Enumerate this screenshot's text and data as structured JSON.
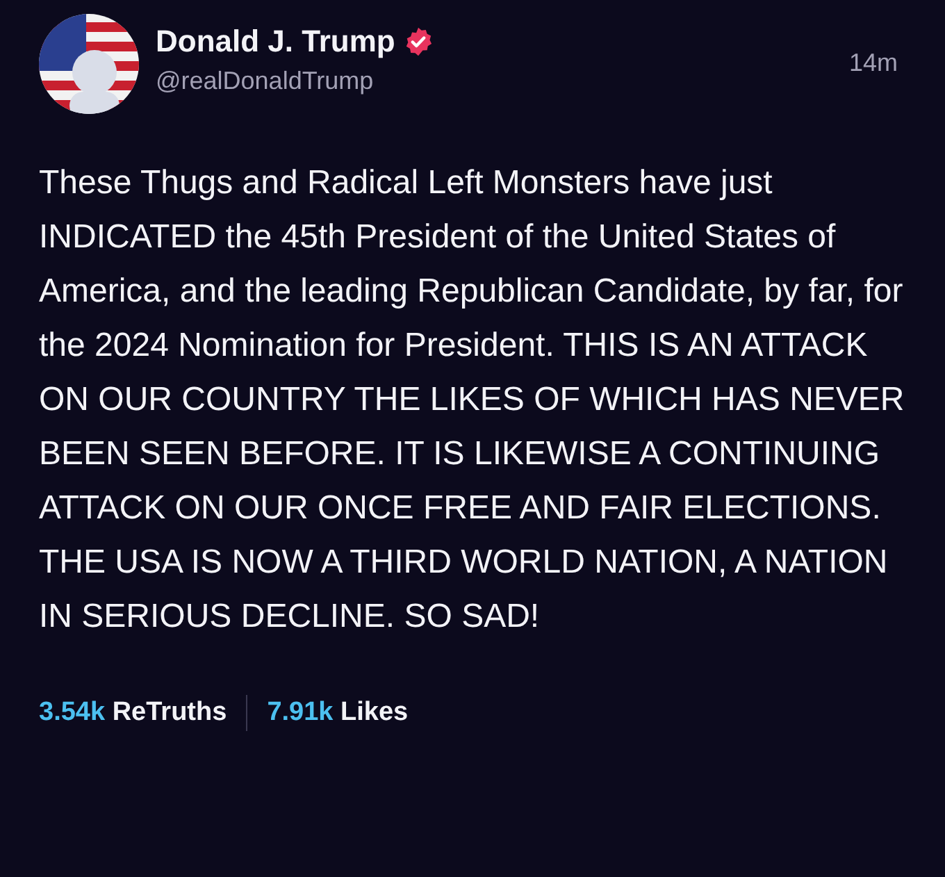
{
  "author": {
    "name": "Donald J. Trump",
    "verified": true,
    "handle": "@realDonaldTrump"
  },
  "time": "14m",
  "body": "These Thugs and Radical Left Monsters have just INDICATED the 45th President of the United States of America, and the leading Republican Candidate, by far, for the 2024 Nomination for President. THIS IS AN ATTACK ON OUR COUNTRY THE LIKES OF WHICH HAS NEVER BEEN SEEN BEFORE. IT IS LIKEWISE A CONTINUING ATTACK ON OUR ONCE FREE AND FAIR ELECTIONS. THE USA IS NOW A THIRD WORLD NATION, A NATION IN SERIOUS DECLINE. SO SAD!",
  "stats": [
    {
      "count": "3.54k",
      "label": "ReTruths"
    },
    {
      "count": "7.91k",
      "label": "Likes"
    }
  ]
}
